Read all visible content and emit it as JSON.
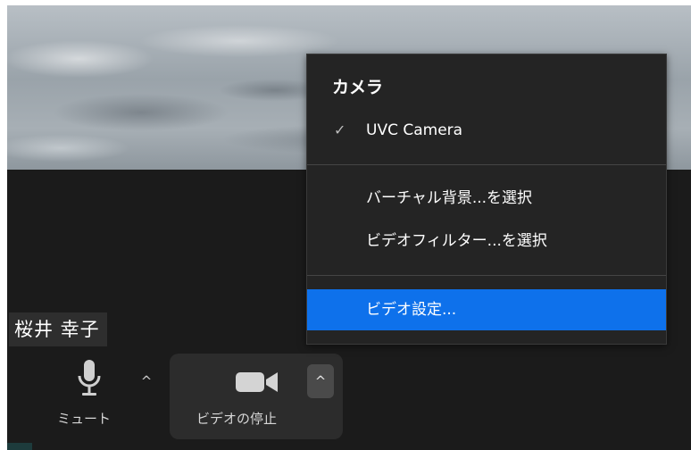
{
  "participant": {
    "name": "桜井 幸子"
  },
  "toolbar": {
    "mute_label": "ミュート",
    "stop_video_label": "ビデオの停止",
    "caret_glyph": "^"
  },
  "menu": {
    "heading": "カメラ",
    "camera_items": [
      {
        "label": "UVC Camera",
        "checked": true,
        "check_glyph": "✓"
      }
    ],
    "background_items": [
      {
        "label": "バーチャル背景...を選択"
      },
      {
        "label": "ビデオフィルター...を選択"
      }
    ],
    "settings_item": {
      "label": "ビデオ設定...",
      "highlighted": true
    }
  },
  "colors": {
    "highlight": "#0e71eb",
    "menu_bg": "#242424",
    "toolbar_bg": "#1b1b1b"
  },
  "icons": [
    "microphone-icon",
    "video-camera-icon",
    "checkmark-icon",
    "caret-up-icon"
  ]
}
